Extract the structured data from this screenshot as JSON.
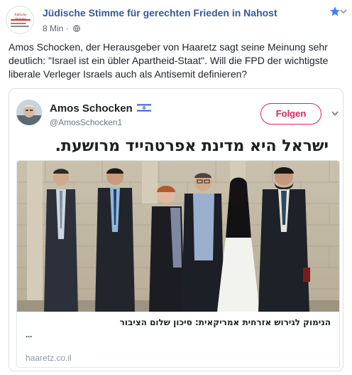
{
  "post": {
    "page_name": "Jüdische Stimme für gerechten Frieden in Nahost",
    "time": "8 Min",
    "separator": "·",
    "logo_text": "Jüdische Stimme",
    "body": "Amos Schocken, der Herausgeber von Haaretz sagt seine Meinung sehr deutlich: \"Israel ist ein übler Apartheid-Staat\". Will die FPD der wichtigste liberale Verleger Israels auch als Antisemit definieren?"
  },
  "tweet": {
    "author_name": "Amos Schocken",
    "handle": "@AmosSchocken1",
    "follow_label": "Folgen",
    "text": "ישראל היא מדינת אפרטהייד מרושעת.",
    "link": {
      "title": "הנימוק לגירוש אזרחית אמריקאית: סיכון שלום הציבור",
      "more": "...",
      "domain": "haaretz.co.il"
    }
  },
  "colors": {
    "page_name": "#385898",
    "follow": "#e0245e",
    "star": "#4080ff",
    "meta": "#616770"
  },
  "icons": [
    "star-icon",
    "chevron-down-icon",
    "globe-icon",
    "israel-flag-icon",
    "caret-down-icon"
  ]
}
